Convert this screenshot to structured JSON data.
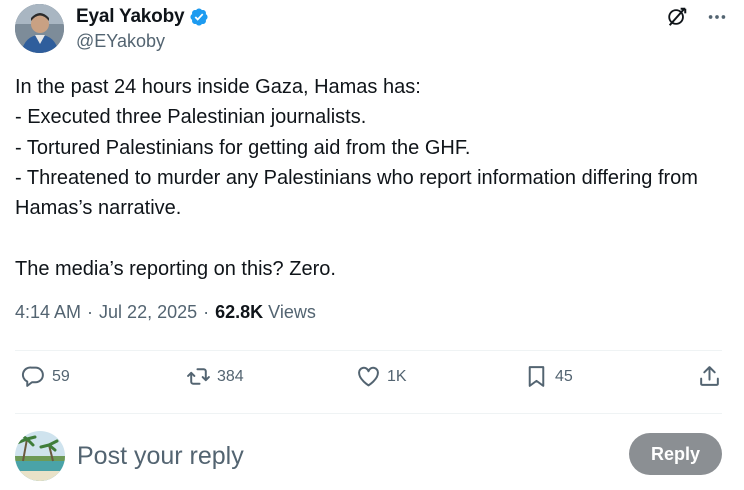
{
  "author": {
    "display_name": "Eyal Yakoby",
    "handle": "@EYakoby",
    "verified": true
  },
  "header_icons": [
    "grok-icon",
    "more-icon"
  ],
  "tweet": {
    "text": "In the past 24 hours inside Gaza, Hamas has:\n- Executed three Palestinian journalists.\n- Tortured Palestinians for getting aid from the GHF.\n- Threatened to murder any Palestinians who report information differing from Hamas’s narrative.\n\nThe media’s reporting on this? Zero.",
    "time": "4:14 AM",
    "separator": "·",
    "date": "Jul 22, 2025",
    "views_count": "62.8K",
    "views_label": "Views"
  },
  "actions": {
    "replies": "59",
    "reposts": "384",
    "likes": "1K",
    "bookmarks": "45"
  },
  "reply_box": {
    "placeholder": "Post your reply",
    "button_label": "Reply"
  },
  "colors": {
    "text_primary": "#0f1419",
    "text_secondary": "#536471",
    "verified_blue": "#1d9bf0",
    "divider": "#eff3f4",
    "reply_button_disabled": "#8b8f93"
  }
}
